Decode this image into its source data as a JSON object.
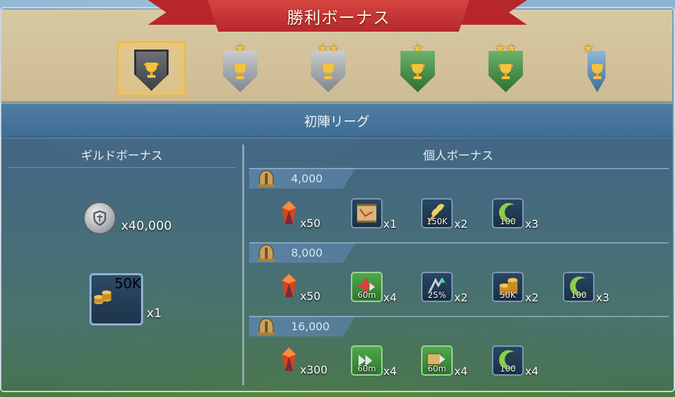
{
  "title": "勝利ボーナス",
  "league": "初陣リーグ",
  "ranks": [
    {
      "name": "rank-1",
      "stars": 0,
      "style": "dark",
      "selected": true
    },
    {
      "name": "rank-2",
      "stars": 1,
      "style": "silver",
      "selected": false
    },
    {
      "name": "rank-3",
      "stars": 2,
      "style": "silver",
      "selected": false
    },
    {
      "name": "rank-4",
      "stars": 1,
      "style": "green",
      "selected": false
    },
    {
      "name": "rank-5",
      "stars": 2,
      "style": "green",
      "selected": false
    },
    {
      "name": "rank-6",
      "stars": 1,
      "style": "blue",
      "selected": false
    }
  ],
  "guild": {
    "title": "ギルドボーナス",
    "coin_qty": "x40,000",
    "gold_label": "50K",
    "gold_qty": "x1"
  },
  "personal": {
    "title": "個人ボーナス",
    "tiers": [
      {
        "value": "4,000",
        "gem_qty": "x50",
        "items": [
          {
            "icon": "map-scroll-icon",
            "label": "",
            "qty": "x1",
            "color": "blue"
          },
          {
            "icon": "wheat-icon",
            "label": "150K",
            "qty": "x2",
            "color": "blue"
          },
          {
            "icon": "green-crescent-icon",
            "label": "100",
            "qty": "x3",
            "color": "blue"
          }
        ]
      },
      {
        "value": "8,000",
        "gem_qty": "x50",
        "items": [
          {
            "icon": "heal-speed-icon",
            "label": "60m",
            "qty": "x4",
            "color": "green"
          },
          {
            "icon": "research-boost-icon",
            "label": "25%",
            "qty": "x2",
            "color": "blue"
          },
          {
            "icon": "gold-coins-icon",
            "label": "50K",
            "qty": "x2",
            "color": "blue"
          },
          {
            "icon": "green-crescent-icon",
            "label": "100",
            "qty": "x3",
            "color": "blue"
          }
        ]
      },
      {
        "value": "16,000",
        "gem_qty": "x300",
        "items": [
          {
            "icon": "speed-arrow-icon",
            "label": "60m",
            "qty": "x4",
            "color": "green"
          },
          {
            "icon": "book-speed-icon",
            "label": "60m",
            "qty": "x4",
            "color": "green"
          },
          {
            "icon": "green-crescent-icon",
            "label": "100",
            "qty": "x4",
            "color": "blue"
          }
        ]
      }
    ]
  },
  "colors": {
    "ribbon": "#b5282b",
    "parchment": "#d8c9a3",
    "league_bar": "#4f7ea4",
    "highlight": "#f2b73a"
  }
}
